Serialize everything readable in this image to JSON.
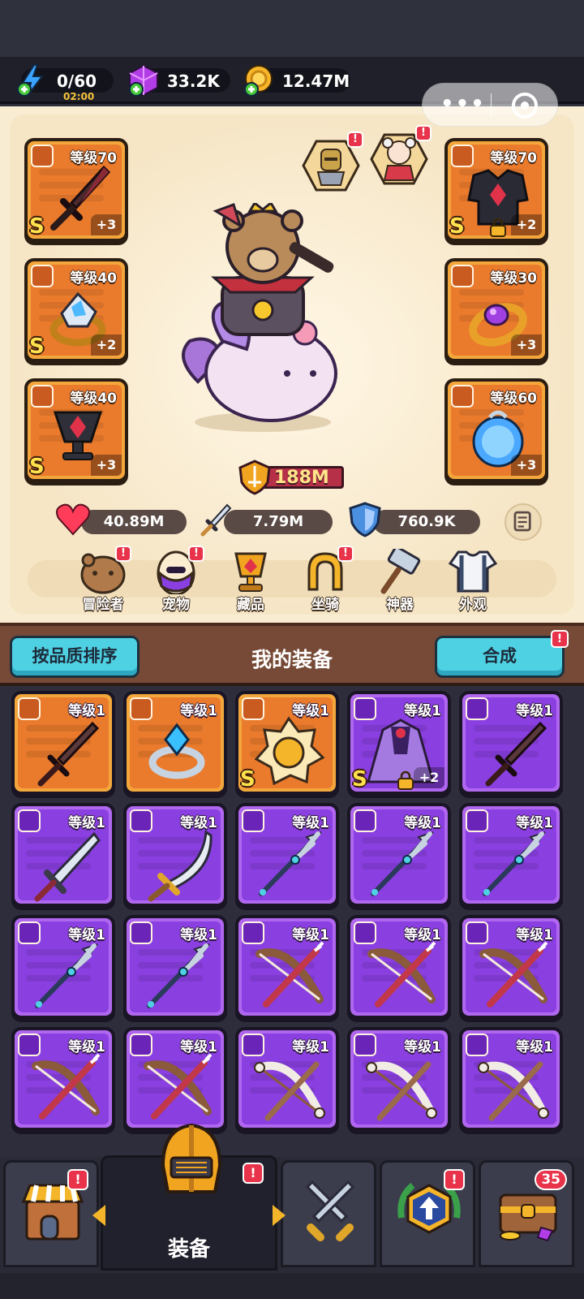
{
  "resources": {
    "energy": "0/60",
    "energy_timer": "02:00",
    "gems": "33.2K",
    "coins": "12.47M"
  },
  "hero": {
    "slots_left": [
      {
        "level": "等级70",
        "plus": "+3",
        "rank": "S",
        "icon": "sword-icon"
      },
      {
        "level": "等级40",
        "plus": "+2",
        "rank": "S",
        "icon": "ring-icon"
      },
      {
        "level": "等级40",
        "plus": "+3",
        "rank": "S",
        "icon": "amulet-icon"
      }
    ],
    "slots_right": [
      {
        "level": "等级70",
        "plus": "+2",
        "rank": "S",
        "icon": "armor-icon"
      },
      {
        "level": "等级30",
        "plus": "+3",
        "rank": "",
        "icon": "ring-icon"
      },
      {
        "level": "等级60",
        "plus": "+3",
        "rank": "",
        "icon": "amulet-icon"
      }
    ],
    "power": "188M",
    "stats": {
      "hp": "40.89M",
      "attack": "7.79M",
      "defense": "760.9K"
    },
    "bang": "!"
  },
  "menu": [
    {
      "label": "冒险者",
      "badge": "!"
    },
    {
      "label": "宠物",
      "badge": "!"
    },
    {
      "label": "藏品",
      "badge": ""
    },
    {
      "label": "坐骑",
      "badge": "!"
    },
    {
      "label": "神器",
      "badge": ""
    },
    {
      "label": "外观",
      "badge": ""
    }
  ],
  "inventory_header": {
    "sort_button": "按品质排序",
    "title": "我的装备",
    "merge_button": "合成",
    "merge_badge": "!"
  },
  "inventory": [
    {
      "rarity": "orange",
      "level": "等级1",
      "kind": "sword",
      "rank": "",
      "plus": ""
    },
    {
      "rarity": "orange",
      "level": "等级1",
      "kind": "ring",
      "rank": "",
      "plus": ""
    },
    {
      "rarity": "orange",
      "level": "等级1",
      "kind": "medal",
      "rank": "S",
      "plus": ""
    },
    {
      "rarity": "purple",
      "level": "等级1",
      "kind": "cloak",
      "rank": "S",
      "plus": "+2"
    },
    {
      "rarity": "purple",
      "level": "等级1",
      "kind": "sword",
      "rank": "",
      "plus": ""
    },
    {
      "rarity": "purple",
      "level": "等级1",
      "kind": "blade",
      "rank": "",
      "plus": ""
    },
    {
      "rarity": "purple",
      "level": "等级1",
      "kind": "scimitar",
      "rank": "",
      "plus": ""
    },
    {
      "rarity": "purple",
      "level": "等级1",
      "kind": "spear",
      "rank": "",
      "plus": ""
    },
    {
      "rarity": "purple",
      "level": "等级1",
      "kind": "spear",
      "rank": "",
      "plus": ""
    },
    {
      "rarity": "purple",
      "level": "等级1",
      "kind": "spear",
      "rank": "",
      "plus": ""
    },
    {
      "rarity": "purple",
      "level": "等级1",
      "kind": "spear",
      "rank": "",
      "plus": ""
    },
    {
      "rarity": "purple",
      "level": "等级1",
      "kind": "spear",
      "rank": "",
      "plus": ""
    },
    {
      "rarity": "purple",
      "level": "等级1",
      "kind": "bow",
      "rank": "",
      "plus": ""
    },
    {
      "rarity": "purple",
      "level": "等级1",
      "kind": "bow",
      "rank": "",
      "plus": ""
    },
    {
      "rarity": "purple",
      "level": "等级1",
      "kind": "bow",
      "rank": "",
      "plus": ""
    },
    {
      "rarity": "purple",
      "level": "等级1",
      "kind": "bow",
      "rank": "",
      "plus": ""
    },
    {
      "rarity": "purple",
      "level": "等级1",
      "kind": "bow",
      "rank": "",
      "plus": ""
    },
    {
      "rarity": "purple",
      "level": "等级1",
      "kind": "bonebow",
      "rank": "",
      "plus": ""
    },
    {
      "rarity": "purple",
      "level": "等级1",
      "kind": "bonebow",
      "rank": "",
      "plus": ""
    },
    {
      "rarity": "purple",
      "level": "等级1",
      "kind": "bonebow",
      "rank": "",
      "plus": ""
    }
  ],
  "bottom_nav": [
    {
      "label": "",
      "icon": "shop-icon",
      "badge": "!"
    },
    {
      "label": "装备",
      "icon": "helmet-icon",
      "badge": "!"
    },
    {
      "label": "",
      "icon": "crossed-swords-icon",
      "badge": ""
    },
    {
      "label": "",
      "icon": "upgrade-icon",
      "badge": "!"
    },
    {
      "label": "",
      "icon": "treasure-chest-icon",
      "badge": "35"
    }
  ],
  "colors": {
    "orange_tile": "#ea7a2c",
    "purple_tile": "#8a3fe0",
    "accent_cyan": "#4fd1e4",
    "badge_red": "#e8334a"
  }
}
